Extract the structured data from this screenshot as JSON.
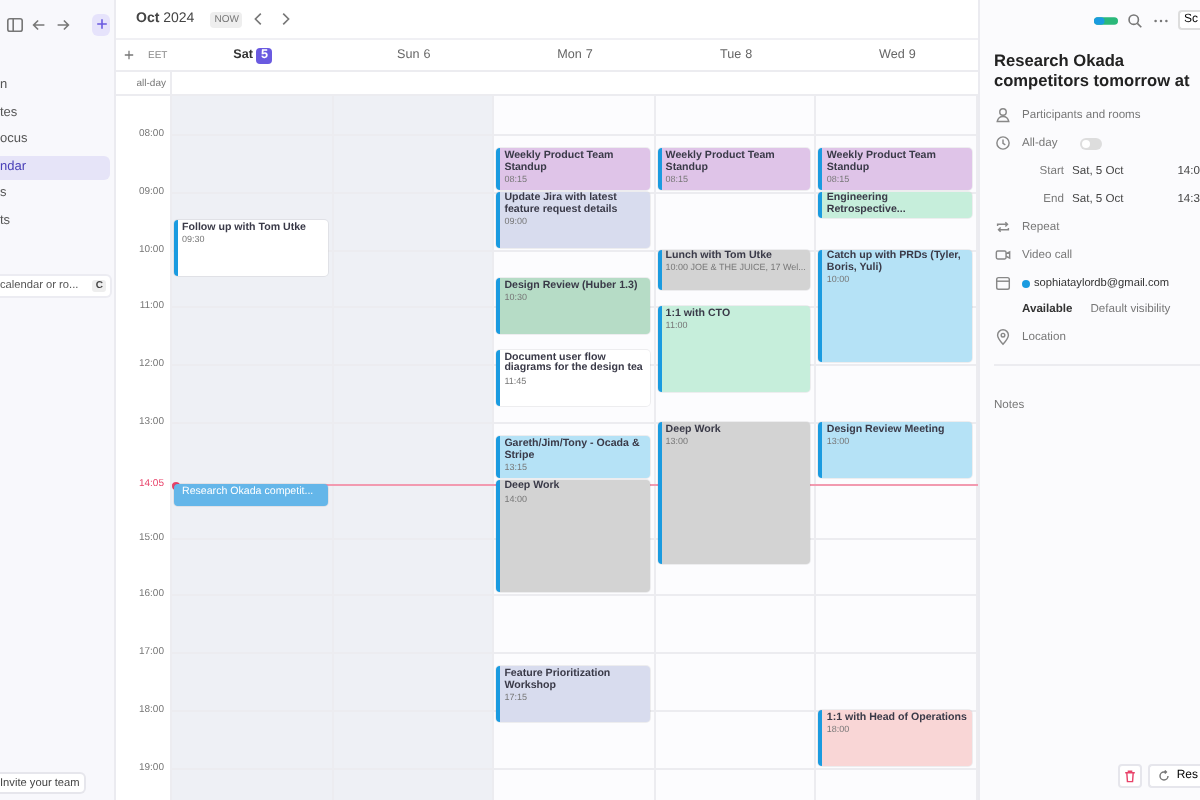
{
  "sidebar": {
    "items": [
      {
        "label": "n",
        "selected": false
      },
      {
        "label": "tes",
        "selected": false
      },
      {
        "label": "ocus",
        "selected": false
      },
      {
        "label": "ndar",
        "selected": true
      },
      {
        "label": "s",
        "selected": false
      },
      {
        "label": "ts",
        "selected": false
      }
    ],
    "search": {
      "placeholder": "calendar or ro...",
      "shortcut": "C"
    },
    "invite_button": "Invite your team"
  },
  "header": {
    "title": "**Oct** 2024",
    "badge": "NOW",
    "timezone": "EET",
    "all_day_label": "all-day"
  },
  "time_labels": [
    "08:00",
    "09:00",
    "10:00",
    "11:00",
    "12:00",
    "13:00",
    "15:00",
    "16:00",
    "17:00",
    "18:00",
    "19:00"
  ],
  "now": {
    "time": "14:05"
  },
  "days": [
    {
      "name": "Sat",
      "date": "5",
      "today": true,
      "weekend": true,
      "events": [
        {
          "title": "Follow up with Tom Utke",
          "time": "09:30",
          "kind": "standard",
          "color": "#ffffff",
          "selected": false
        },
        {
          "title": "Research Okada competit...",
          "kind": "now",
          "color": "#64b6e9",
          "selected": true
        }
      ]
    },
    {
      "name": "Sun",
      "date": "6",
      "today": false,
      "weekend": true
    },
    {
      "name": "Mon",
      "date": "7",
      "today": false,
      "weekend": false,
      "events": [
        {
          "title": "Weekly Product Team Standup",
          "time": "08:15",
          "kind": "compact",
          "color": "#dfc4e8",
          "selected": false
        },
        {
          "title": "Update Jira with latest feature request details",
          "time": "09:00",
          "kind": "standard",
          "color": "#d8dcee",
          "selected": false
        },
        {
          "title": "Design Review (Huber 1.3)",
          "time": "10:30",
          "kind": "standard",
          "color": "#b6dcc6",
          "selected": false
        },
        {
          "title": "Document user flow diagrams for the design tea",
          "time": "11:45",
          "kind": "standard",
          "color": "#ffffff",
          "selected": false
        },
        {
          "title": "Gareth/Jim/Tony - Ocada & Stripe",
          "time": "13:15",
          "kind": "compact",
          "color": "#b5e2f6",
          "selected": false
        },
        {
          "title": "Deep Work",
          "time": "14:00",
          "kind": "long",
          "color": "#d3d3d3",
          "selected": false
        },
        {
          "title": "Feature Prioritization Workshop",
          "time": "17:15",
          "kind": "standard",
          "color": "#d8dcee",
          "selected": false
        }
      ]
    },
    {
      "name": "Tue",
      "date": "8",
      "today": false,
      "weekend": false,
      "events": [
        {
          "title": "Weekly Product Team Standup",
          "time": "08:15",
          "kind": "compact",
          "color": "#dfc4e8",
          "selected": false
        },
        {
          "title": "Lunch with Tom Utke",
          "time": "10:00 JOE & THE JUICE, 17 Wel...",
          "kind": "compact",
          "color": "#d3d3d3",
          "selected": false
        },
        {
          "title": "1:1 with CTO",
          "time": "11:00",
          "kind": "tall",
          "color": "#c6eedb",
          "selected": false
        },
        {
          "title": "Deep Work",
          "time": "13:00",
          "kind": "xlong",
          "color": "#d3d3d3",
          "selected": false
        }
      ]
    },
    {
      "name": "Wed",
      "date": "9",
      "today": false,
      "weekend": false,
      "events": [
        {
          "title": "Weekly Product Team Standup",
          "time": "08:15",
          "kind": "compact",
          "color": "#dfc4e8",
          "selected": false
        },
        {
          "title": "Engineering Retrospective...",
          "kind": "short",
          "color": "#c6eedb",
          "selected": false
        },
        {
          "title": "Catch up with PRDs (Tyler, Boris, Yuli)",
          "time": "10:00",
          "kind": "long",
          "color": "#b5e2f6",
          "selected": false
        },
        {
          "title": "Design Review Meeting",
          "time": "13:00",
          "kind": "standard",
          "color": "#b5e2f6",
          "selected": false
        },
        {
          "title": "1:1 with Head of Operations",
          "time": "18:00",
          "kind": "standard",
          "color": "#f9d6d6",
          "selected": false
        }
      ]
    }
  ],
  "panel": {
    "top_button": "Sc",
    "title": "Research Okada competitors tomorrow at",
    "participants": "Participants and rooms",
    "all_day": {
      "label": "All-day",
      "on": false
    },
    "start": {
      "label": "Start",
      "date": "Sat, 5 Oct",
      "time": "14:0"
    },
    "end": {
      "label": "End",
      "date": "Sat, 5 Oct",
      "time": "14:3"
    },
    "repeat": "Repeat",
    "video_call": "Video call",
    "calendar": {
      "email": "sophiataylordb@gmail.com",
      "color": "#1a9be0"
    },
    "availability": "Available",
    "visibility": "Default visibility",
    "location": "Location",
    "notes": "Notes",
    "bottom_button": "Res"
  }
}
